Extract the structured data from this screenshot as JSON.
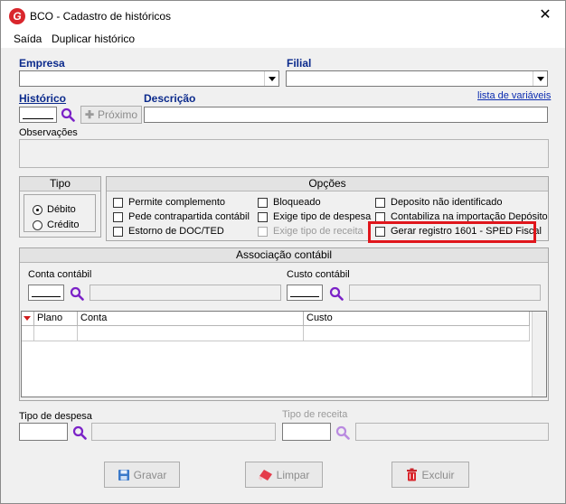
{
  "window": {
    "title": "BCO - Cadastro de históricos",
    "app_icon_letter": "G"
  },
  "menu": {
    "items": [
      "Saída",
      "Duplicar histórico"
    ]
  },
  "empresa": {
    "label": "Empresa",
    "value": ""
  },
  "filial": {
    "label": "Filial",
    "value": ""
  },
  "historico": {
    "label": "Histórico",
    "code": "",
    "next_label": "Próximo"
  },
  "descricao": {
    "label": "Descrição",
    "value": "",
    "link_label": "lista de variáveis"
  },
  "observacoes": {
    "label": "Observações",
    "value": ""
  },
  "tipo": {
    "header": "Tipo",
    "options": [
      "Débito",
      "Crédito"
    ],
    "selected": "Débito"
  },
  "opcoes": {
    "header": "Opções",
    "items": [
      "Permite complemento",
      "Pede contrapartida contábil",
      "Estorno de DOC/TED",
      "Bloqueado",
      "Exige tipo de despesa",
      "Exige tipo de receita",
      "Deposito não identificado",
      "Contabiliza na importação Depósito",
      "Gerar registro 1601 - SPED Fiscal"
    ],
    "highlight_color": "#e0161c"
  },
  "associacao": {
    "header": "Associação contábil",
    "conta_label": "Conta contábil",
    "custo_label": "Custo contábil",
    "columns": [
      "Plano",
      "Conta",
      "Custo"
    ]
  },
  "tipo_despesa": {
    "label": "Tipo de despesa",
    "value": ""
  },
  "tipo_receita": {
    "label": "Tipo de receita",
    "value": ""
  },
  "actions": {
    "gravar": "Gravar",
    "limpar": "Limpar",
    "excluir": "Excluir"
  },
  "colors": {
    "label_blue": "#0b2a8c",
    "search_purple": "#7b22c7",
    "accent_red": "#d9262c"
  }
}
